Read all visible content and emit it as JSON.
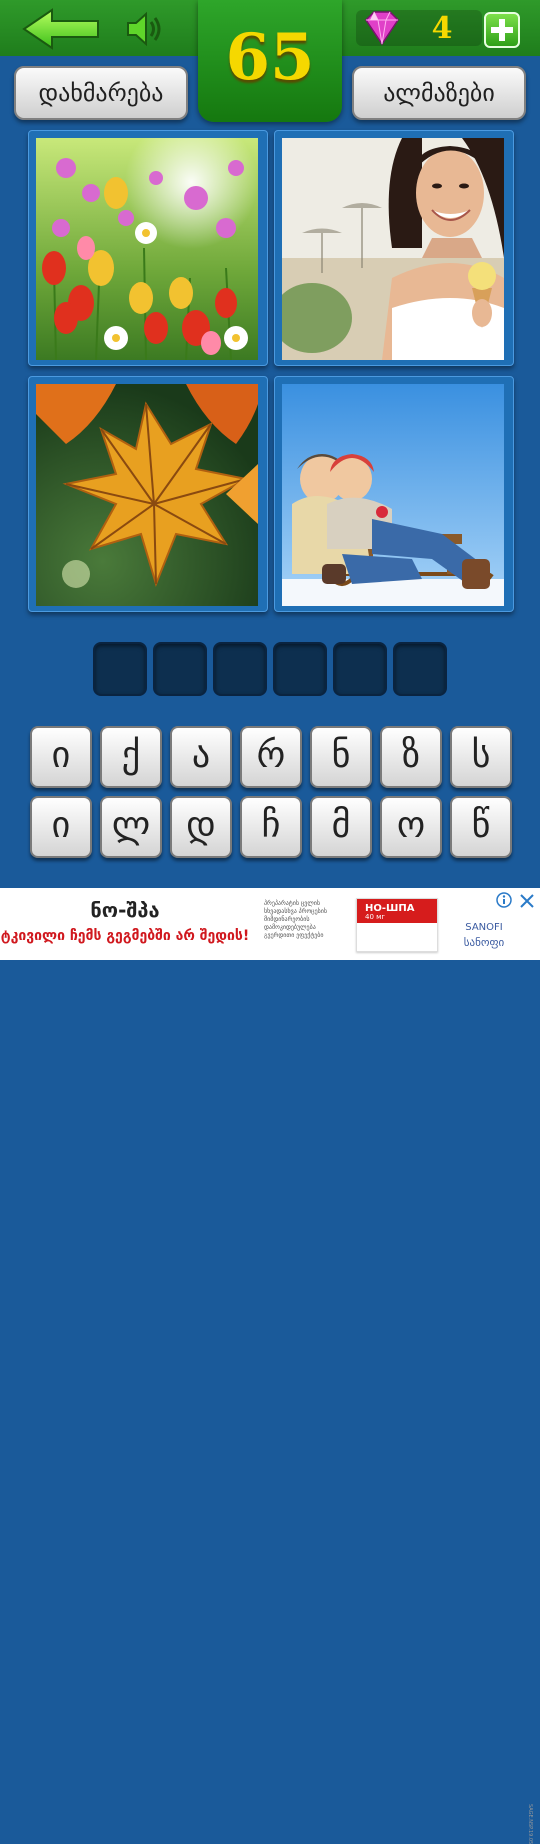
{
  "header": {
    "level": "65",
    "gem_count": "4",
    "back_icon": "arrow-left-icon",
    "sound_icon": "speaker-icon",
    "gem_icon": "diamond-icon",
    "add_icon": "plus-icon",
    "colors": {
      "bar": "#1f7d1c",
      "level_text": "#f5d800",
      "background": "#1a5a9a"
    }
  },
  "buttons": {
    "help_label": "დახმარება",
    "gems_label": "ალმაზები"
  },
  "images": [
    {
      "subject": "flowers"
    },
    {
      "subject": "woman-with-ice-cream"
    },
    {
      "subject": "autumn-leaves"
    },
    {
      "subject": "couple-on-sled"
    }
  ],
  "answer_slots": [
    "",
    "",
    "",
    "",
    "",
    ""
  ],
  "keyboard": {
    "row1": [
      "ი",
      "ქ",
      "ა",
      "რ",
      "ნ",
      "ზ",
      "ს"
    ],
    "row2": [
      "ი",
      "ლ",
      "დ",
      "ჩ",
      "მ",
      "ო",
      "წ"
    ]
  },
  "ad": {
    "title": "ნო-შპა",
    "slogan": "ტკივილი ჩემს გეგმებში არ შედის!",
    "fine_print": [
      "პრეპარატის ცვლის",
      "სხვადასხვა პროცესის",
      "მიმდინარეობის",
      "დამოკიდებულება",
      "გვერდითი ეფექტები"
    ],
    "product_name": "НО-ШПА",
    "product_dose": "40 мг",
    "brand_latin": "SANOFI",
    "brand_local": "სანოფი",
    "side_text": "SAGE.NSP.19.05",
    "info_icon": "info-icon",
    "close_icon": "close-icon"
  }
}
